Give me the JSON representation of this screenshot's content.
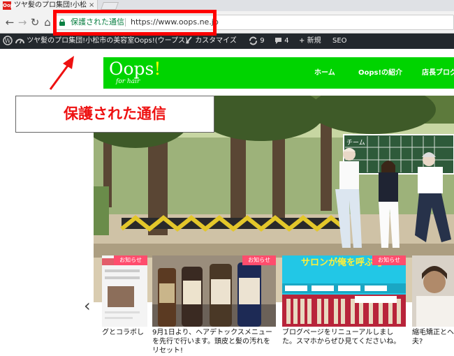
{
  "browser": {
    "tab_title": "ツヤ髪のプロ集団!小松市の",
    "tab_close": "×",
    "favicon_text": "Oops",
    "secure_label": "保護された通信",
    "url": "https://www.oops.ne.jp"
  },
  "adminbar": {
    "site_name": "ツヤ髪のプロ集団!小松市の美容室Oops!(ウープス)",
    "customize": "カスタマイズ",
    "updates_count": "9",
    "comments_count": "4",
    "new_label": "新規",
    "seo_label": "SEO"
  },
  "site": {
    "logo_text": "Oops",
    "logo_bang": "!",
    "tagline": "for hair",
    "nav": [
      "ホーム",
      "Oops!の紹介",
      "店長ブログ"
    ]
  },
  "annotation": {
    "callout_text": "保護された通信"
  },
  "hero": {
    "scoreboard_label": "チーム"
  },
  "slider": {
    "cards": [
      {
        "badge": "お知らせ",
        "caption": "グとコラボし"
      },
      {
        "badge": "お知らせ",
        "caption": "9月1日より、ヘアデトックスメニューを先行で行います。頭皮と髪の汚れをリセット!"
      },
      {
        "badge": "お知らせ",
        "caption": "ブログページをリニューアルしました。スマホからぜひ見てくださいね。"
      },
      {
        "badge": "",
        "caption": "縮毛矯正とヘ夫?"
      }
    ],
    "banner_text": "サロンが俺を呼ぶ!」"
  },
  "colors": {
    "green_header": "#00d400",
    "admin_bar": "#23282d",
    "callout_red": "#ee1111",
    "highlight_box": "#ff0000",
    "badge_pink": "#ff4d6d"
  }
}
